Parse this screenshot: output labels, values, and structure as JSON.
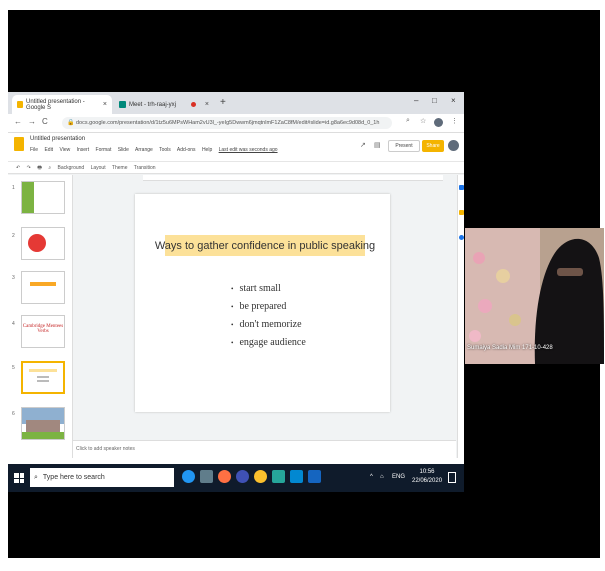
{
  "browser": {
    "tabs": [
      {
        "label": "Untitled presentation - Google S",
        "close": "×"
      },
      {
        "label": "Meet - trh-raaj-yxj",
        "close": "×"
      }
    ],
    "new_tab": "+",
    "window_controls": [
      "–",
      "□",
      "×"
    ],
    "url": "docs.google.com/presentation/d/1tz5u6MPsWHam2vU3l_-yeIg5Dwwm6jmqtnlmF1ZaC8fM/edit#slide=id.g8a6ec9d08d_0_1h"
  },
  "slides_app": {
    "doc_title": "Untitled presentation",
    "menus": [
      "File",
      "Edit",
      "View",
      "Insert",
      "Format",
      "Slide",
      "Arrange",
      "Tools",
      "Add-ons",
      "Help",
      "Last edit was seconds ago"
    ],
    "present_label": "Present",
    "share_label": "Share",
    "toolbar_items": [
      "↶",
      "↷",
      "🖶",
      "⌕",
      "Background",
      "Layout",
      "Theme",
      "Transition"
    ],
    "notes_placeholder": "Click to add speaker notes",
    "thumb_numbers": [
      "1",
      "2",
      "3",
      "4",
      "5",
      "6"
    ],
    "thumb4_text": "Cambridge Mentees Verbs"
  },
  "slide": {
    "title": "Ways to gather confidence in public speaking",
    "bullets": [
      "start small",
      "be prepared",
      "don't memorize",
      "engage audience"
    ]
  },
  "taskbar": {
    "search_placeholder": "Type here to search",
    "tray_text": "ENG",
    "time": "10:56",
    "date": "22/06/2020"
  },
  "webcam": {
    "name_label": "Sumaiya Sadia Mim 171-10-428"
  },
  "colors": {
    "slides_yellow": "#f4b400",
    "title_highlight": "#fce199",
    "taskbar": "#0f1b2b"
  }
}
